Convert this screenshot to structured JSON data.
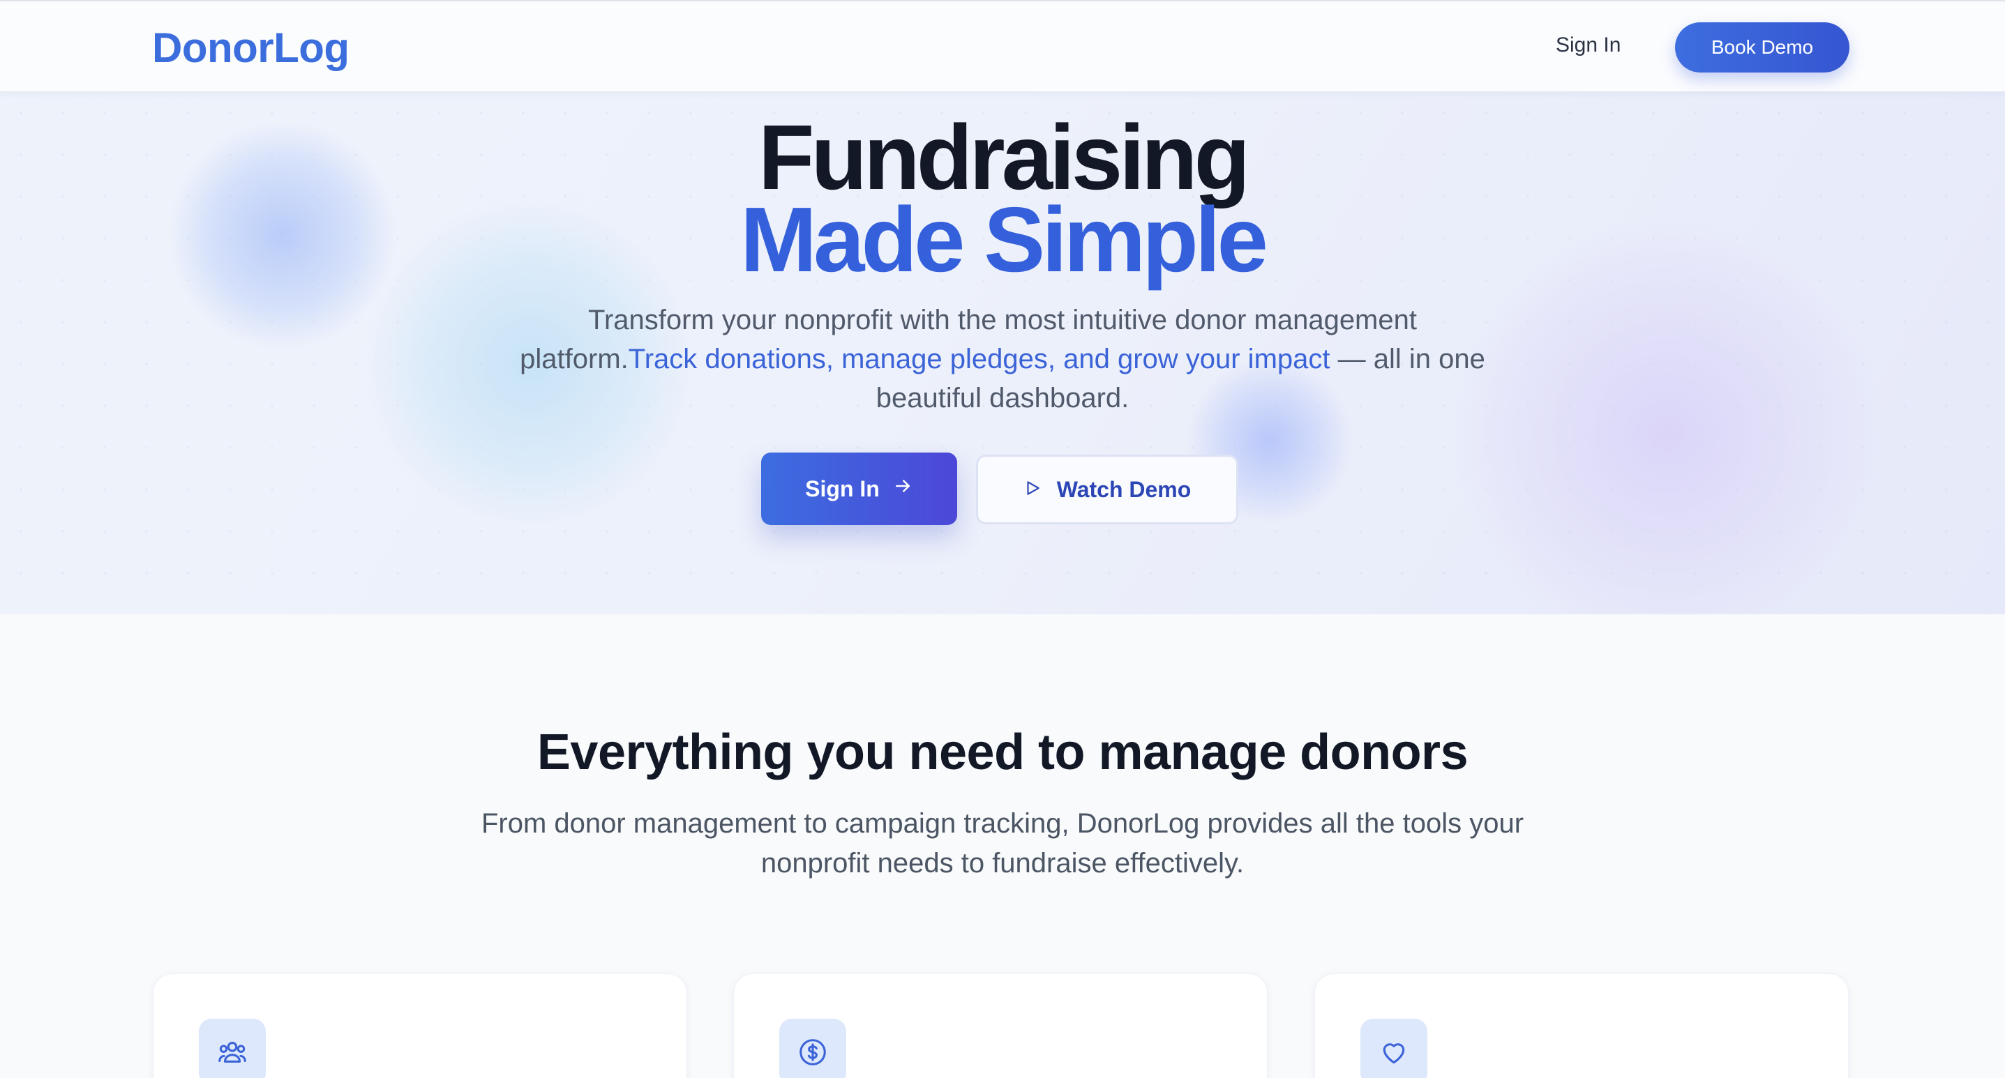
{
  "nav": {
    "logo": "DonorLog",
    "sign_in": "Sign In",
    "book_demo": "Book Demo"
  },
  "hero": {
    "title_line1": "Fundraising",
    "title_line2": "Made Simple",
    "subtitle_part1": "Transform your nonprofit with the most intuitive donor management platform.",
    "subtitle_highlight": "Track donations, manage pledges, and grow your impact",
    "subtitle_part2": " — all in one beautiful dashboard.",
    "primary_cta": "Sign In",
    "secondary_cta": "Watch Demo"
  },
  "features": {
    "title": "Everything you need to manage donors",
    "subtitle": "From donor management to campaign tracking, DonorLog provides all the tools your nonprofit needs to fundraise effectively.",
    "cards": [
      {
        "icon": "users-icon"
      },
      {
        "icon": "dollar-circle-icon"
      },
      {
        "icon": "heart-icon"
      }
    ]
  },
  "colors": {
    "brand": "#3b6ddd",
    "accent_gradient_start": "#3c6de0",
    "accent_gradient_end": "#4c48d8",
    "heading": "#121826",
    "body_text": "#4b5563"
  }
}
